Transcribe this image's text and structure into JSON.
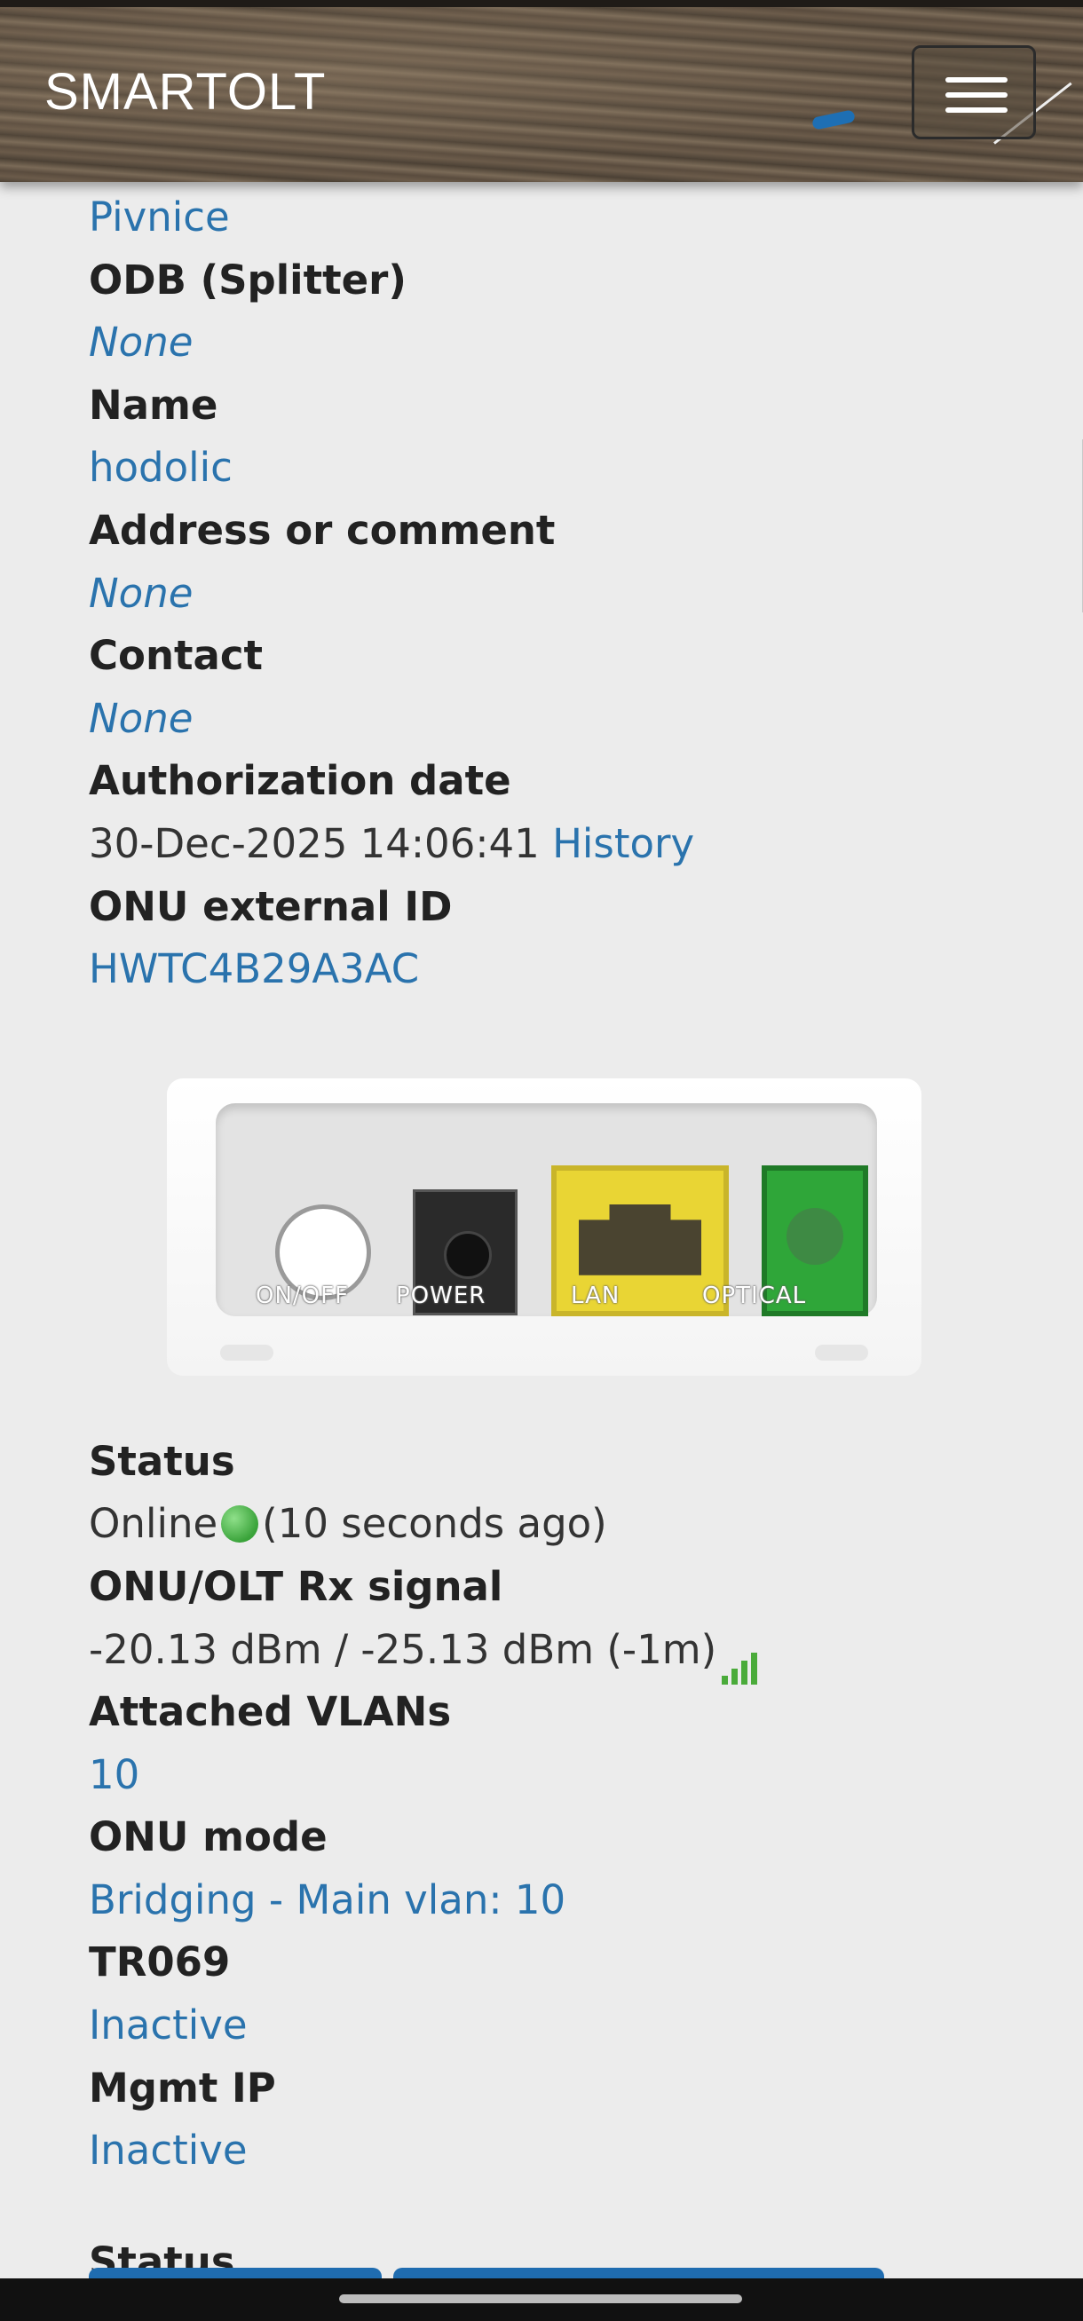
{
  "navbar": {
    "brand": "SMARTOLT"
  },
  "details": {
    "zone_value": "Pivnice",
    "odb_label": "ODB (Splitter)",
    "odb_value": "None",
    "name_label": "Name",
    "name_value": "hodolic",
    "address_label": "Address or comment",
    "address_value": "None",
    "contact_label": "Contact",
    "contact_value": "None",
    "auth_label": "Authorization date",
    "auth_value": "30-Dec-2025 14:06:41",
    "history_link": "History",
    "extid_label": "ONU external ID",
    "extid_value": "HWTC4B29A3AC"
  },
  "device": {
    "ports": [
      "ON/OFF",
      "POWER",
      "LAN",
      "OPTICAL"
    ]
  },
  "status": {
    "status_label": "Status",
    "status_value": "Online",
    "status_ago": "(10 seconds ago)",
    "signal_label": "ONU/OLT Rx signal",
    "signal_value": "-20.13 dBm / -25.13 dBm (-1m)",
    "vlans_label": "Attached VLANs",
    "vlans_value": "10",
    "mode_label": "ONU mode",
    "mode_value": "Bridging - Main vlan: 10",
    "tr069_label": "TR069",
    "tr069_value": "Inactive",
    "mgmt_label": "Mgmt IP",
    "mgmt_value": "Inactive",
    "section2_label": "Status"
  },
  "colors": {
    "link": "#2a73ad",
    "online": "#3aa33a",
    "signal": "#4aab3a"
  },
  "icons": [
    "menu-icon",
    "globe-icon",
    "signal-bars-icon"
  ]
}
